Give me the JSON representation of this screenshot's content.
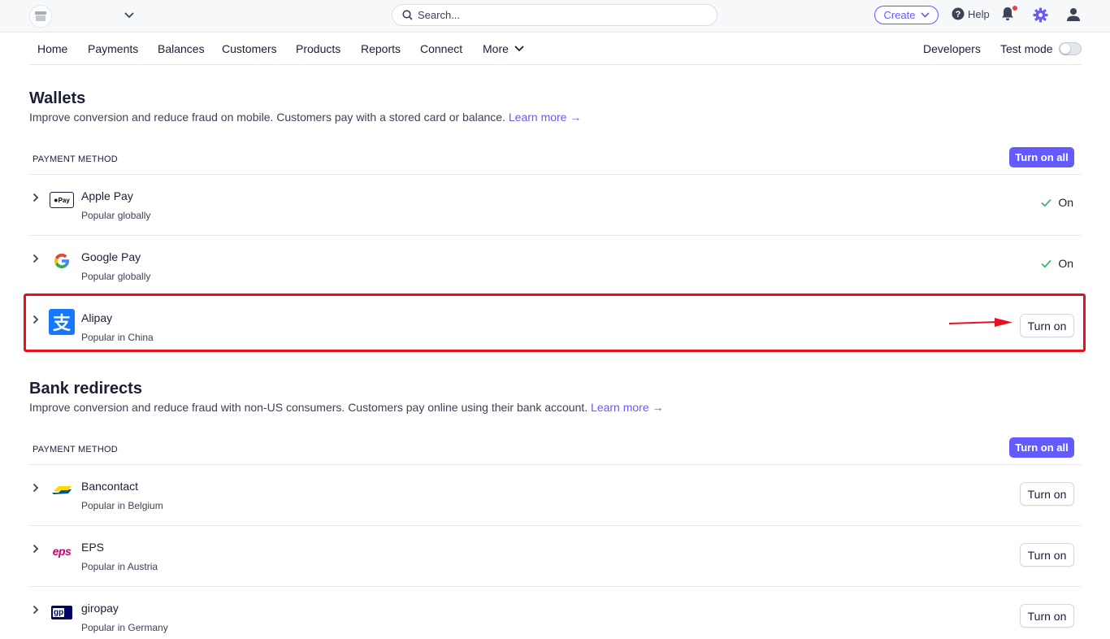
{
  "topbar": {
    "search_placeholder": "Search...",
    "create_label": "Create",
    "help_label": "Help"
  },
  "nav": {
    "items": [
      "Home",
      "Payments",
      "Balances",
      "Customers",
      "Products",
      "Reports",
      "Connect"
    ],
    "more_label": "More",
    "developers_label": "Developers",
    "test_mode_label": "Test mode",
    "test_mode_on": false
  },
  "wallets": {
    "title": "Wallets",
    "description": "Improve conversion and reduce fraud on mobile. Customers pay with a stored card or balance.",
    "learn_more": "Learn more →",
    "column_header": "PAYMENT METHOD",
    "turn_on_all": "Turn on all",
    "methods": [
      {
        "name": "Apple Pay",
        "subtitle": "Popular globally",
        "status": "On",
        "logo_text": "Pay"
      },
      {
        "name": "Google Pay",
        "subtitle": "Popular globally",
        "status": "On",
        "logo_text": "G"
      },
      {
        "name": "Alipay",
        "subtitle": "Popular in China",
        "action": "Turn on",
        "logo_text": "支"
      }
    ]
  },
  "bank_redirects": {
    "title": "Bank redirects",
    "description": "Improve conversion and reduce fraud with non-US consumers. Customers pay online using their bank account.",
    "learn_more": "Learn more →",
    "column_header": "PAYMENT METHOD",
    "turn_on_all": "Turn on all",
    "methods": [
      {
        "name": "Bancontact",
        "subtitle": "Popular in Belgium",
        "action": "Turn on"
      },
      {
        "name": "EPS",
        "subtitle": "Popular in Austria",
        "action": "Turn on",
        "logo_text": "eps"
      },
      {
        "name": "giropay",
        "subtitle": "Popular in Germany",
        "action": "Turn on",
        "logo_text": "gp"
      }
    ]
  },
  "colors": {
    "accent": "#635bff",
    "success": "#3cb371",
    "highlight": "#e8101e",
    "text": "#1a1f36"
  }
}
